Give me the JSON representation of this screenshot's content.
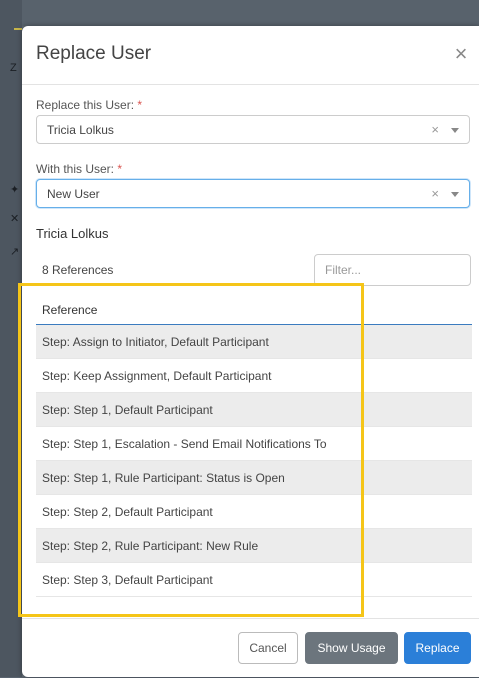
{
  "modal": {
    "title": "Replace User",
    "close_icon": "×"
  },
  "replace_field": {
    "label": "Replace this User:",
    "required_mark": "*",
    "value": "Tricia Lolkus",
    "clear_icon": "×"
  },
  "with_field": {
    "label": "With this User:",
    "required_mark": "*",
    "value": "New User",
    "clear_icon": "×"
  },
  "user_heading": "Tricia Lolkus",
  "references": {
    "count_label": "8 References",
    "filter_placeholder": "Filter...",
    "column_header": "Reference",
    "rows": [
      "Step: Assign to Initiator, Default Participant",
      "Step: Keep Assignment, Default Participant",
      "Step: Step 1, Default Participant",
      "Step: Step 1, Escalation - Send Email Notifications To",
      "Step: Step 1, Rule Participant: Status is Open",
      "Step: Step 2, Default Participant",
      "Step: Step 2, Rule Participant: New Rule",
      "Step: Step 3, Default Participant"
    ]
  },
  "footer": {
    "cancel_label": "Cancel",
    "show_usage_label": "Show Usage",
    "replace_label": "Replace"
  },
  "colors": {
    "primary": "#2b7fd8",
    "secondary": "#6c757d",
    "highlight": "#f5c518",
    "required": "#d9534f"
  }
}
